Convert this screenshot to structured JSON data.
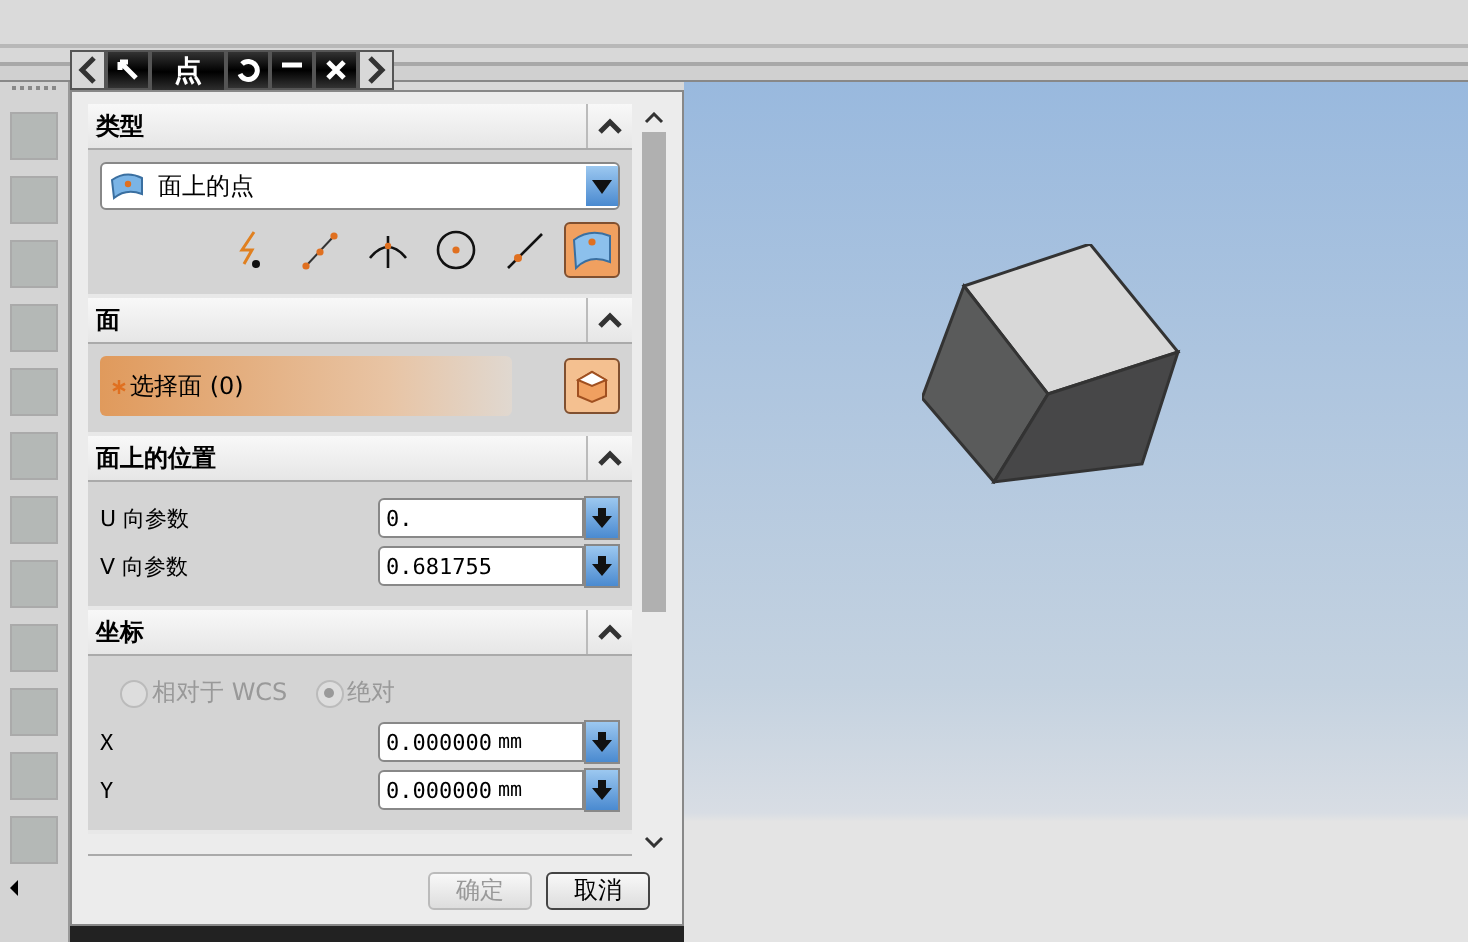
{
  "dialog": {
    "title": "点",
    "sections": [
      {
        "kind": "type",
        "title": "类型",
        "expanded": true,
        "dropdown": "面上的点",
        "methods": [
          {
            "selected": false
          },
          {
            "selected": false
          },
          {
            "selected": false
          },
          {
            "selected": false
          },
          {
            "selected": false
          },
          {
            "selected": true
          }
        ]
      },
      {
        "kind": "face",
        "title": "面",
        "expanded": true,
        "select_label": "选择面 (0)"
      },
      {
        "kind": "position",
        "title": "面上的位置",
        "expanded": true,
        "params": [
          {
            "label": "U 向参数",
            "value": "0."
          },
          {
            "label": "V 向参数",
            "value": "0.681755"
          }
        ]
      },
      {
        "kind": "coords",
        "title": "坐标",
        "expanded": true,
        "radios": [
          {
            "label": "相对于 WCS",
            "selected": false,
            "disabled": true
          },
          {
            "label": "绝对",
            "selected": true,
            "disabled": true
          }
        ],
        "fields": [
          {
            "label": "X",
            "value": "0.000000",
            "unit": "mm"
          },
          {
            "label": "Y",
            "value": "0.000000",
            "unit": "mm"
          }
        ]
      }
    ],
    "buttons": [
      {
        "label": "确定",
        "disabled": true
      },
      {
        "label": "取消",
        "disabled": false
      }
    ]
  }
}
